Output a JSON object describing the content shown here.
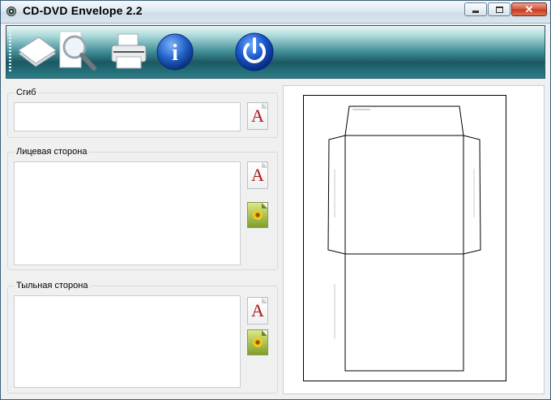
{
  "window": {
    "title": "CD-DVD Envelope 2.2",
    "controls": {
      "minimize": "minimize",
      "maximize": "maximize",
      "close": "close"
    }
  },
  "toolbar": {
    "buttons": [
      {
        "name": "new-document",
        "icon": "papers-icon"
      },
      {
        "name": "preview",
        "icon": "magnifier-icon"
      },
      {
        "name": "print",
        "icon": "printer-icon"
      },
      {
        "name": "about",
        "icon": "info-icon",
        "glyph": "i"
      },
      {
        "name": "exit",
        "icon": "power-icon"
      }
    ]
  },
  "groups": {
    "fold": {
      "label": "Сгиб",
      "text": ""
    },
    "front": {
      "label": "Лицевая сторона",
      "text": ""
    },
    "back": {
      "label": "Тыльная сторона",
      "text": ""
    }
  },
  "buttons": {
    "font_glyph": "A"
  },
  "colors": {
    "toolbar_dark": "#1c5862",
    "toolbar_light": "#a9d7d8",
    "accent_blue": "#1f5fc4",
    "font_red": "#b01818"
  }
}
